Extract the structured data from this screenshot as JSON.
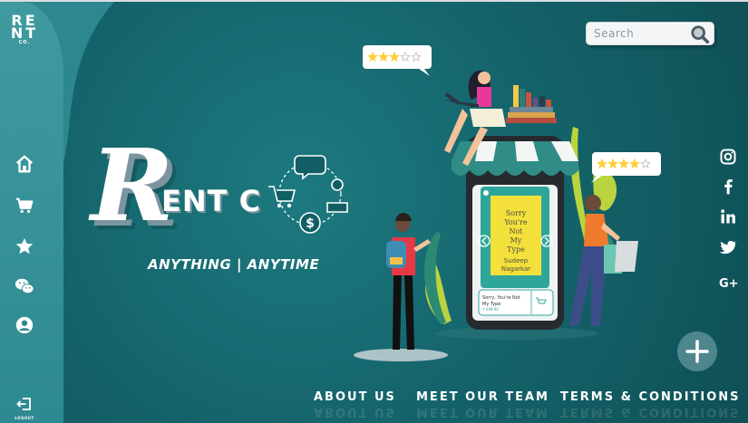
{
  "logo": {
    "line1": "RE",
    "line2": "NT",
    "sub": "CO."
  },
  "sidebar": {
    "items": [
      {
        "icon": "home-icon"
      },
      {
        "icon": "cart-icon"
      },
      {
        "icon": "star-icon"
      },
      {
        "icon": "wechat-icon"
      },
      {
        "icon": "user-icon"
      }
    ],
    "logout_label": "LOGOUT"
  },
  "search": {
    "placeholder": "Search"
  },
  "hero": {
    "brand_letter": "R",
    "brand_rest": "ENT C",
    "tagline": "ANYTHING | ANYTIME"
  },
  "social": [
    "instagram-icon",
    "facebook-icon",
    "linkedin-icon",
    "twitter-icon",
    "google-plus-icon"
  ],
  "social_text": {
    "google_plus": "G+"
  },
  "footer_nav": {
    "about": "ABOUT US",
    "team": "MEET OUR TEAM",
    "terms": "TERMS & CONDITIONS"
  },
  "phone_card": {
    "book_title": "Sorry You're Not My Type",
    "book_author": "Sudeep Nagarkar",
    "book_lines": [
      "Sorry",
      "You're",
      "Not",
      "My",
      "Type"
    ],
    "price": "₹ 299.00"
  },
  "ratings": {
    "left_bubble": 3,
    "right_bubble": 4,
    "max": 5
  },
  "colors": {
    "bg": "#15656c",
    "panel": "#3f9aa0",
    "accent": "#ffcf3f"
  }
}
